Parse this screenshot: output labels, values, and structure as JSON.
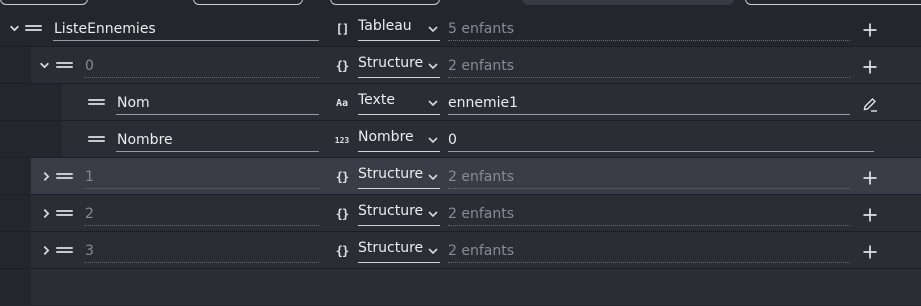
{
  "rows": [
    {
      "name": "ListeEnnemies",
      "type_icon": "[]",
      "type": "Tableau",
      "value": "5 enfants",
      "action_icon": "plus-icon",
      "expanded": true
    },
    {
      "name": "0",
      "type_icon": "{}",
      "type": "Structure",
      "value": "2 enfants",
      "action_icon": "plus-icon",
      "expanded": true
    },
    {
      "name": "Nom",
      "type_icon": "Aa",
      "type": "Texte",
      "value": "ennemie1",
      "action_icon": "edit-icon"
    },
    {
      "name": "Nombre",
      "type_icon": "123",
      "type": "Nombre",
      "value": "0"
    },
    {
      "name": "1",
      "type_icon": "{}",
      "type": "Structure",
      "value": "2 enfants",
      "action_icon": "plus-icon",
      "expanded": false,
      "selected": true
    },
    {
      "name": "2",
      "type_icon": "{}",
      "type": "Structure",
      "value": "2 enfants",
      "action_icon": "plus-icon",
      "expanded": false
    },
    {
      "name": "3",
      "type_icon": "{}",
      "type": "Structure",
      "value": "2 enfants",
      "action_icon": "plus-icon",
      "expanded": false
    }
  ],
  "colors": {
    "background": "#25252c",
    "row_indent": "#2c2c34",
    "selected_row": "#3b3c48",
    "text": "#ececf0",
    "muted_text": "#8a8a94"
  }
}
